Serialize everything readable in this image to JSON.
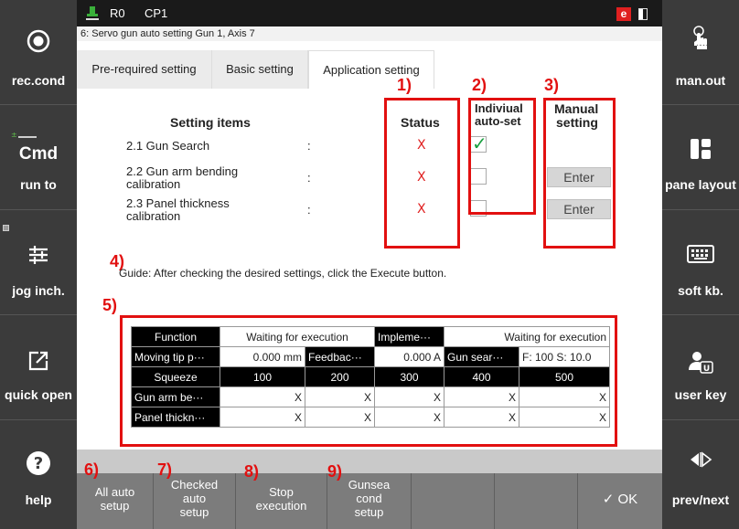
{
  "header": {
    "robot_id": "R0",
    "program": "CP1",
    "error_badge": "e",
    "window_title": "6: Servo gun auto setting Gun 1, Axis 7"
  },
  "left_sidebar": [
    {
      "label": "rec.cond",
      "icon": "record-icon"
    },
    {
      "label": "run to",
      "cmd": "Cmd",
      "icon": "cmd-icon"
    },
    {
      "label": "jog inch.",
      "icon": "sliders-icon"
    },
    {
      "label": "quick open",
      "icon": "open-external-icon"
    },
    {
      "label": "help",
      "icon": "help-icon"
    }
  ],
  "right_sidebar": [
    {
      "label": "man.out",
      "icon": "hand-pointer-icon"
    },
    {
      "label": "pane layout",
      "icon": "pane-layout-icon"
    },
    {
      "label": "soft kb.",
      "icon": "keyboard-icon"
    },
    {
      "label": "user key",
      "icon": "user-key-icon"
    },
    {
      "label": "prev/next",
      "icon": "prev-next-icon"
    }
  ],
  "tabs": [
    {
      "label": "Pre-required setting"
    },
    {
      "label": "Basic setting"
    },
    {
      "label": "Application setting",
      "active": true
    }
  ],
  "settings": {
    "heading": "Setting items",
    "status_heading": "Status",
    "autoset_heading_1": "Indiviual",
    "autoset_heading_2": "auto-set",
    "manual_heading_1": "Manual",
    "manual_heading_2": "setting",
    "items": [
      {
        "line1": "2.1 Gun Search",
        "line2": "",
        "colon": ":",
        "status": "X",
        "checked": true,
        "manual": ""
      },
      {
        "line1": "2.2 Gun arm bending",
        "line2": "calibration",
        "colon": ":",
        "status": "X",
        "checked": false,
        "manual": "Enter"
      },
      {
        "line1": "2.3 Panel thickness",
        "line2": "calibration",
        "colon": ":",
        "status": "X",
        "checked": false,
        "manual": "Enter"
      }
    ]
  },
  "annotations": {
    "a1": "1)",
    "a2": "2)",
    "a3": "3)",
    "a4": "4)",
    "a5": "5)",
    "a6": "6)",
    "a7": "7)",
    "a8": "8)",
    "a9": "9)"
  },
  "guide": "Guide: After checking the desired settings, click the Execute button.",
  "table": {
    "row1": [
      "Function",
      "Waiting for execution",
      "Impleme···",
      "Waiting for execution"
    ],
    "row2": [
      "Moving tip p···",
      "0.000 mm",
      "Feedbac···",
      "0.000 A",
      "Gun sear···",
      "F: 100  S: 10.0"
    ],
    "row3": [
      "Squeeze",
      "100",
      "200",
      "300",
      "400",
      "500"
    ],
    "row4": [
      "Gun arm be···",
      "X",
      "X",
      "X",
      "X",
      "X"
    ],
    "row5": [
      "Panel thickn···",
      "X",
      "X",
      "X",
      "X",
      "X"
    ]
  },
  "bottom_buttons": [
    {
      "l1": "All auto",
      "l2": "setup",
      "l3": ""
    },
    {
      "l1": "Checked",
      "l2": "auto",
      "l3": "setup"
    },
    {
      "l1": "Stop",
      "l2": "execution",
      "l3": ""
    },
    {
      "l1": "Gunsea",
      "l2": "cond",
      "l3": "setup"
    },
    {
      "l1": "",
      "l2": "",
      "l3": ""
    },
    {
      "l1": "",
      "l2": "",
      "l3": ""
    },
    {
      "l1": "✓ OK",
      "l2": "",
      "l3": ""
    }
  ],
  "colors": {
    "accent_red": "#e21010",
    "check_green": "#1aa040",
    "sidebar_bg": "#3b3b3b"
  }
}
